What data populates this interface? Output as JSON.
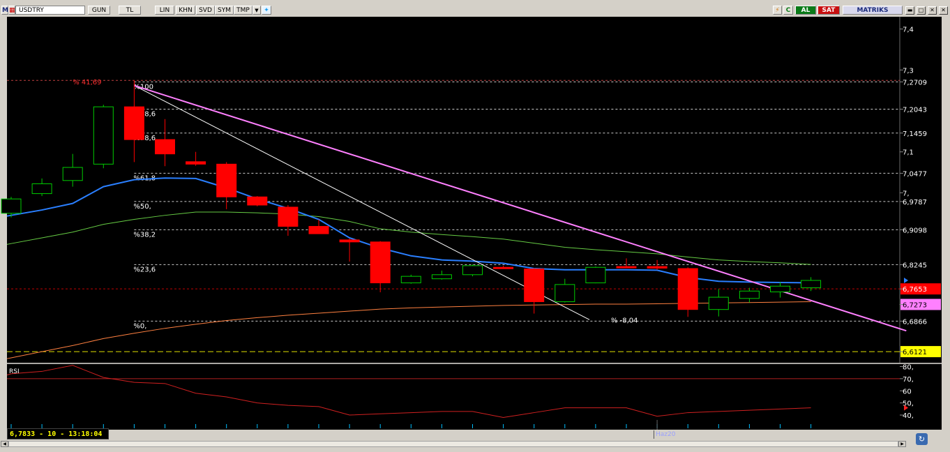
{
  "toolbar": {
    "logo": "M",
    "symbol": "USDTRY",
    "buttons": [
      "GUN",
      "TL",
      "LIN",
      "KHN",
      "SVD",
      "SYM",
      "TMP"
    ],
    "buy_label": "AL",
    "sell_label": "SAT",
    "brand": "MATRIKS",
    "c_label": "C"
  },
  "colors": {
    "background": "#000000",
    "bull": "#00cc00",
    "bear": "#ff0000",
    "ma_blue": "#2a7fff",
    "ma_green": "#66cc44",
    "ma_orange": "#ff8040",
    "trend_pink": "#ff80ff",
    "fib_line": "#cccccc",
    "rsi": "#d02020"
  },
  "chart_data": {
    "type": "candlestick",
    "symbol": "USDTRY",
    "ylim": [
      6.585,
      7.43
    ],
    "y_ticks": [
      "7,4",
      "7,3",
      "7,1",
      "7,"
    ],
    "price_labels": [
      {
        "text": "7,2709",
        "value": 7.2709,
        "bg": "",
        "fg": "#ffffff"
      },
      {
        "text": "7,2043",
        "value": 7.2043,
        "bg": "",
        "fg": "#ffffff"
      },
      {
        "text": "7,1459",
        "value": 7.1459,
        "bg": "",
        "fg": "#ffffff"
      },
      {
        "text": "7,0477",
        "value": 7.0477,
        "bg": "",
        "fg": "#ffffff"
      },
      {
        "text": "6,9787",
        "value": 6.9787,
        "bg": "",
        "fg": "#ffffff"
      },
      {
        "text": "6,9098",
        "value": 6.9098,
        "bg": "",
        "fg": "#ffffff"
      },
      {
        "text": "6,8245",
        "value": 6.8245,
        "bg": "",
        "fg": "#ffffff"
      },
      {
        "text": "6,7653",
        "value": 6.7653,
        "bg": "#ff0000",
        "fg": "#ffffff"
      },
      {
        "text": "6,7273",
        "value": 6.7273,
        "bg": "#ff80ff",
        "fg": "#000000"
      },
      {
        "text": "6,6866",
        "value": 6.6866,
        "bg": "",
        "fg": "#ffffff"
      },
      {
        "text": "6,6121",
        "value": 6.6121,
        "bg": "#ffff00",
        "fg": "#000000"
      }
    ],
    "fib_levels": [
      {
        "label": "%100",
        "value": 7.2709
      },
      {
        "label": "%88,6",
        "value": 7.2043
      },
      {
        "label": "%78,6",
        "value": 7.1459
      },
      {
        "label": "%61,8",
        "value": 7.0477
      },
      {
        "label": "%50,",
        "value": 6.9787
      },
      {
        "label": "%38,2",
        "value": 6.9098
      },
      {
        "label": "%23,6",
        "value": 6.8245
      },
      {
        "label": "%0,",
        "value": 6.6866
      }
    ],
    "annotations": [
      {
        "text": "% 41,69",
        "x": 2,
        "y": 7.265,
        "color": "#ff3030"
      },
      {
        "text": "% -8,04",
        "x": 19.5,
        "y": 6.683,
        "color": "#ffffff"
      }
    ],
    "hlines": [
      {
        "value": 7.2745,
        "color": "#c04040",
        "dash": "3,3"
      },
      {
        "value": 6.7653,
        "color": "#c00000",
        "dash": "3,3"
      },
      {
        "value": 6.6121,
        "color": "#e0e000",
        "dash": "8,4"
      }
    ],
    "candles": [
      {
        "o": 6.95,
        "h": 6.99,
        "l": 6.94,
        "c": 6.985
      },
      {
        "o": 6.998,
        "h": 7.035,
        "l": 6.992,
        "c": 7.022
      },
      {
        "o": 7.03,
        "h": 7.095,
        "l": 7.015,
        "c": 7.062
      },
      {
        "o": 7.07,
        "h": 7.215,
        "l": 7.06,
        "c": 7.21
      },
      {
        "o": 7.21,
        "h": 7.275,
        "l": 7.075,
        "c": 7.13
      },
      {
        "o": 7.13,
        "h": 7.18,
        "l": 7.065,
        "c": 7.095
      },
      {
        "o": 7.076,
        "h": 7.1,
        "l": 7.066,
        "c": 7.07
      },
      {
        "o": 7.07,
        "h": 7.075,
        "l": 6.96,
        "c": 6.99
      },
      {
        "o": 6.99,
        "h": 6.992,
        "l": 6.967,
        "c": 6.97
      },
      {
        "o": 6.965,
        "h": 6.97,
        "l": 6.895,
        "c": 6.918
      },
      {
        "o": 6.918,
        "h": 6.935,
        "l": 6.902,
        "c": 6.9
      },
      {
        "o": 6.885,
        "h": 6.888,
        "l": 6.832,
        "c": 6.88
      },
      {
        "o": 6.88,
        "h": 6.882,
        "l": 6.757,
        "c": 6.78
      },
      {
        "o": 6.78,
        "h": 6.8,
        "l": 6.778,
        "c": 6.796
      },
      {
        "o": 6.79,
        "h": 6.81,
        "l": 6.788,
        "c": 6.8
      },
      {
        "o": 6.8,
        "h": 6.825,
        "l": 6.796,
        "c": 6.822
      },
      {
        "o": 6.818,
        "h": 6.822,
        "l": 6.814,
        "c": 6.816
      },
      {
        "o": 6.814,
        "h": 6.816,
        "l": 6.705,
        "c": 6.734
      },
      {
        "o": 6.734,
        "h": 6.79,
        "l": 6.732,
        "c": 6.776
      },
      {
        "o": 6.78,
        "h": 6.82,
        "l": 6.779,
        "c": 6.818
      },
      {
        "o": 6.82,
        "h": 6.84,
        "l": 6.816,
        "c": 6.818
      },
      {
        "o": 6.82,
        "h": 6.836,
        "l": 6.812,
        "c": 6.816
      },
      {
        "o": 6.815,
        "h": 6.818,
        "l": 6.697,
        "c": 6.715
      },
      {
        "o": 6.715,
        "h": 6.765,
        "l": 6.698,
        "c": 6.745
      },
      {
        "o": 6.742,
        "h": 6.768,
        "l": 6.732,
        "c": 6.76
      },
      {
        "o": 6.758,
        "h": 6.782,
        "l": 6.744,
        "c": 6.772
      },
      {
        "o": 6.768,
        "h": 6.794,
        "l": 6.76,
        "c": 6.786
      }
    ],
    "ma_blue": [
      6.945,
      6.958,
      6.974,
      7.015,
      7.032,
      7.036,
      7.035,
      7.012,
      6.985,
      6.962,
      6.935,
      6.89,
      6.865,
      6.846,
      6.836,
      6.833,
      6.828,
      6.815,
      6.812,
      6.812,
      6.812,
      6.811,
      6.793,
      6.784,
      6.782,
      6.781,
      6.78
    ],
    "ma_green": [
      6.876,
      6.89,
      6.904,
      6.923,
      6.935,
      6.945,
      6.953,
      6.953,
      6.951,
      6.948,
      6.942,
      6.93,
      6.912,
      6.904,
      6.898,
      6.893,
      6.887,
      6.877,
      6.867,
      6.861,
      6.856,
      6.851,
      6.843,
      6.836,
      6.832,
      6.829,
      6.825
    ],
    "ma_orange": [
      6.597,
      6.612,
      6.627,
      6.644,
      6.657,
      6.669,
      6.679,
      6.688,
      6.695,
      6.701,
      6.706,
      6.711,
      6.716,
      6.719,
      6.721,
      6.723,
      6.725,
      6.726,
      6.727,
      6.728,
      6.728,
      6.729,
      6.73,
      6.731,
      6.732,
      6.733,
      6.734
    ],
    "trend_white": {
      "x1": 4,
      "y1": 7.262,
      "x2": 18.8,
      "y2": 6.69
    },
    "trend_pink": {
      "x1": 4,
      "y1": 7.262,
      "x2": 29.1,
      "y2": 6.663
    },
    "rsi": {
      "label": "RSI",
      "y_ticks": [
        "80,",
        "70,",
        "60",
        "50,",
        "40,"
      ],
      "ylim": [
        36,
        82
      ],
      "level": 70,
      "values": [
        73,
        74,
        76,
        81,
        71,
        67,
        66,
        58,
        55,
        50,
        48,
        47,
        40,
        41,
        42,
        43,
        43,
        38,
        42,
        46,
        46,
        46,
        39,
        42,
        43,
        44,
        45,
        46
      ]
    },
    "x_label": "Haz20",
    "x_label_index": 21
  },
  "status": {
    "readout": "6,7833 - 10 - 13:18:04"
  }
}
